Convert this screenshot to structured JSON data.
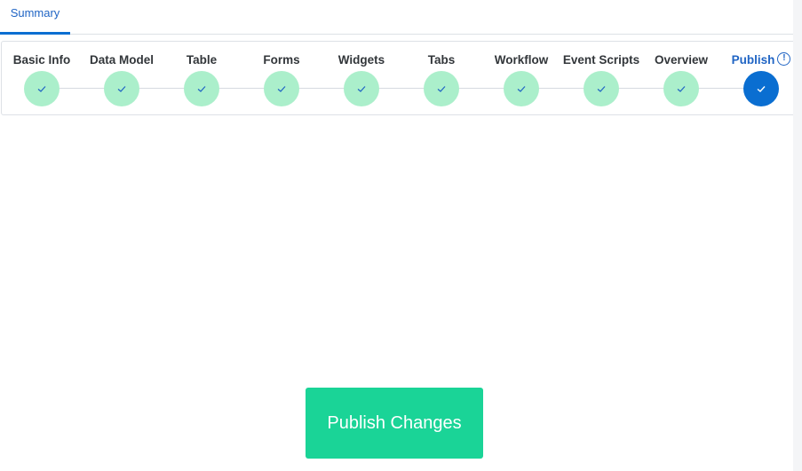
{
  "tabs": [
    {
      "label": "Summary",
      "active": true
    }
  ],
  "steps": [
    {
      "label": "Basic Info",
      "status": "complete",
      "icon": "check-icon"
    },
    {
      "label": "Data Model",
      "status": "complete",
      "icon": "check-icon"
    },
    {
      "label": "Table",
      "status": "complete",
      "icon": "check-icon"
    },
    {
      "label": "Forms",
      "status": "complete",
      "icon": "check-icon"
    },
    {
      "label": "Widgets",
      "status": "complete",
      "icon": "check-icon"
    },
    {
      "label": "Tabs",
      "status": "complete",
      "icon": "check-icon"
    },
    {
      "label": "Workflow",
      "status": "complete",
      "icon": "check-icon"
    },
    {
      "label": "Event Scripts",
      "status": "complete",
      "icon": "check-icon"
    },
    {
      "label": "Overview",
      "status": "complete",
      "icon": "check-icon"
    },
    {
      "label": "Publish",
      "status": "active",
      "icon": "check-icon",
      "badge_icon": "info-icon",
      "badge_glyph": "!"
    }
  ],
  "publish_button": {
    "label": "Publish Changes"
  },
  "colors": {
    "accent": "#0a6ed1",
    "complete_step": "#abefcb",
    "publish_button": "#1ad497"
  }
}
